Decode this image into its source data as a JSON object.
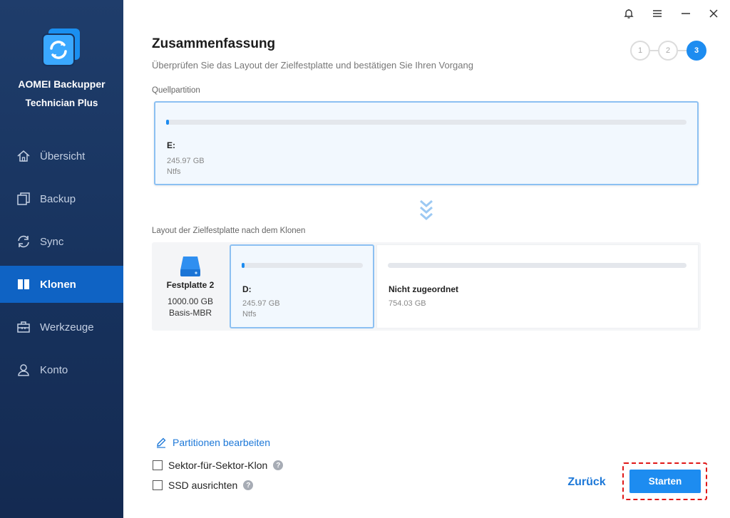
{
  "app": {
    "name_line1": "AOMEI Backupper",
    "name_line2": "Technician Plus"
  },
  "sidebar": {
    "items": [
      {
        "label": "Übersicht",
        "icon": "home-icon",
        "active": false
      },
      {
        "label": "Backup",
        "icon": "backup-icon",
        "active": false
      },
      {
        "label": "Sync",
        "icon": "sync-icon",
        "active": false
      },
      {
        "label": "Klonen",
        "icon": "clone-icon",
        "active": true
      },
      {
        "label": "Werkzeuge",
        "icon": "toolbox-icon",
        "active": false
      },
      {
        "label": "Konto",
        "icon": "user-icon",
        "active": false
      }
    ]
  },
  "header": {
    "title": "Zusammenfassung",
    "subtitle": "Überprüfen Sie das Layout der Zielfestplatte und bestätigen Sie Ihren Vorgang",
    "steps": [
      "1",
      "2",
      "3"
    ],
    "active_step": 3
  },
  "source": {
    "label": "Quellpartition",
    "partition": {
      "letter": "E:",
      "size": "245.97 GB",
      "fs": "Ntfs"
    }
  },
  "target": {
    "label": "Layout der Zielfestplatte nach dem Klonen",
    "disk": {
      "name": "Festplatte 2",
      "size": "1000.00 GB",
      "type": "Basis-MBR"
    },
    "partition": {
      "letter": "D:",
      "size": "245.97 GB",
      "fs": "Ntfs"
    },
    "unallocated": {
      "label": "Nicht zugeordnet",
      "size": "754.03 GB"
    }
  },
  "options": {
    "edit_partitions": "Partitionen bearbeiten",
    "sector_clone": "Sektor-für-Sektor-Klon",
    "ssd_align": "SSD ausrichten",
    "help": "?"
  },
  "buttons": {
    "back": "Zurück",
    "start": "Starten"
  },
  "colors": {
    "sidebar": "#17325d",
    "active_nav": "#0f63c4",
    "accent": "#1d8cf0",
    "highlight": "#e01818"
  }
}
